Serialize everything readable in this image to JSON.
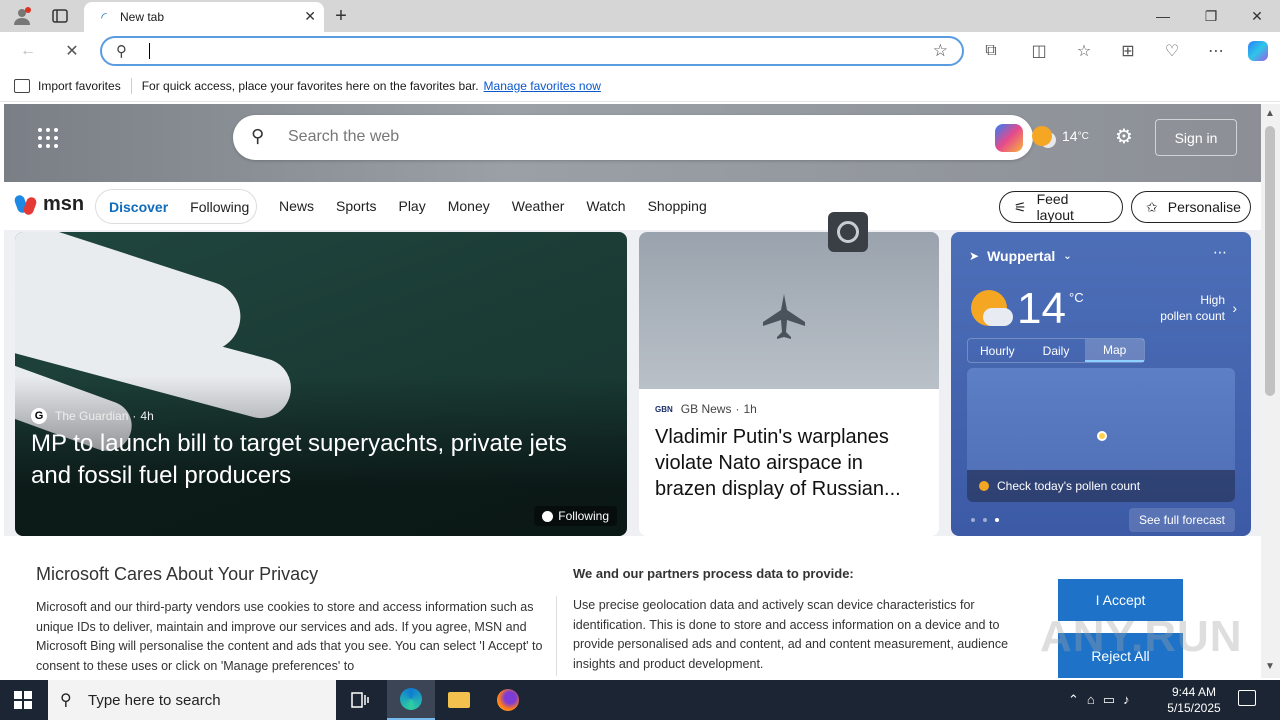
{
  "browser": {
    "tab_title": "New tab",
    "address_value": "",
    "favorites_import": "Import favorites",
    "favorites_hint": "For quick access, place your favorites here on the favorites bar.",
    "favorites_link": "Manage favorites now"
  },
  "msn_header": {
    "search_placeholder": "Search the web",
    "weather_temp": "14",
    "weather_unit": "°C",
    "signin": "Sign in"
  },
  "msn_nav": {
    "logo": "msn",
    "discover": "Discover",
    "following": "Following",
    "items": [
      "News",
      "Sports",
      "Play",
      "Money",
      "Weather",
      "Watch",
      "Shopping"
    ],
    "feed_layout": "Feed layout",
    "personalise": "Personalise"
  },
  "main_story": {
    "source": "The Guardian",
    "age": "4h",
    "headline": "MP to launch bill to target superyachts, private jets and fossil fuel producers",
    "follow_label": "Following"
  },
  "news_story": {
    "source_logo": "GBN",
    "source": "GB News",
    "age": "1h",
    "headline": "Vladimir Putin's warplanes violate Nato airspace in brazen display of Russian..."
  },
  "weather_card": {
    "location": "Wuppertal",
    "temp": "14",
    "unit": "°C",
    "pollen_line1": "High",
    "pollen_line2": "pollen count",
    "tabs": [
      "Hourly",
      "Daily",
      "Map"
    ],
    "active_tab": "Map",
    "pollen_check": "Check today's pollen count",
    "full_forecast": "See full forecast"
  },
  "privacy": {
    "title": "Microsoft Cares About Your Privacy",
    "body": "Microsoft and our third-party vendors use cookies to store and access information such as unique IDs to deliver, maintain and improve our services and ads. If you agree, MSN and Microsoft Bing will personalise the content and ads that you see. You can select 'I Accept' to consent to these uses or click on 'Manage preferences' to",
    "title2": "We and our partners process data to provide:",
    "body2": "Use precise geolocation data and actively scan device characteristics for identification. This is done to store and access information on a device and to provide personalised ads and content, ad and content measurement, audience insights and product development.",
    "accept": "I Accept",
    "reject": "Reject All"
  },
  "watermark": "ANY.RUN",
  "taskbar": {
    "search_placeholder": "Type here to search",
    "time": "9:44 AM",
    "date": "5/15/2025"
  },
  "colors": {
    "accent": "#0f6cbd",
    "weather_card": "#4d6fb8",
    "button_blue": "#1e73c8"
  }
}
